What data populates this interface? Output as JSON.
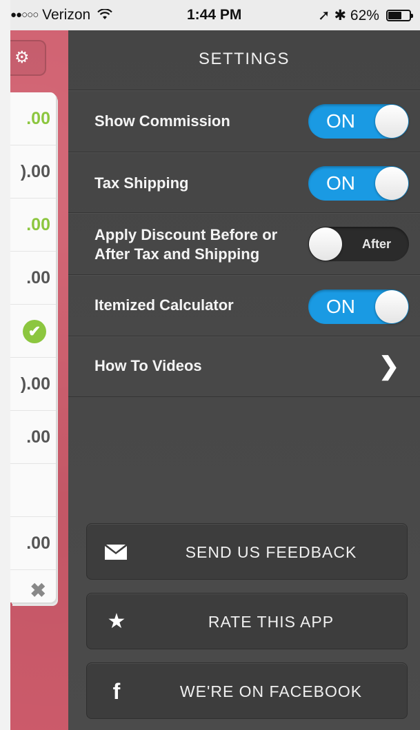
{
  "status_bar": {
    "signal_dots": "●●○○○",
    "carrier": "Verizon",
    "wifi_icon": "wifi-icon",
    "time": "1:44 PM",
    "location_icon": "➚",
    "bluetooth_icon": "✱",
    "battery_percent": "62%"
  },
  "background_app": {
    "gear_icon": "⚙",
    "rows": [
      {
        "text": ".00",
        "style": "green"
      },
      {
        "text": ").00",
        "style": "gray"
      },
      {
        "text": ".00",
        "style": "green"
      },
      {
        "text": ".00",
        "style": "gray"
      },
      {
        "text": "✔",
        "style": "check"
      },
      {
        "text": ").00",
        "style": "gray"
      },
      {
        "text": ".00",
        "style": "gray"
      },
      {
        "text": "",
        "style": "blank"
      },
      {
        "text": ".00",
        "style": "gray"
      }
    ],
    "close_icon": "✖"
  },
  "settings": {
    "title": "SETTINGS",
    "show_commission": {
      "label": "Show Commission",
      "state": "ON"
    },
    "tax_shipping": {
      "label": "Tax Shipping",
      "state": "ON"
    },
    "apply_discount": {
      "label_line1": "Apply Discount Before or",
      "label_line2": "After Tax and Shipping",
      "state": "After"
    },
    "itemized_calculator": {
      "label": "Itemized Calculator",
      "state": "ON"
    },
    "how_to_videos": {
      "label": "How To Videos",
      "chevron": "❯"
    }
  },
  "buttons": {
    "feedback": {
      "label": "SEND US FEEDBACK",
      "icon": "envelope-icon"
    },
    "rate": {
      "label": "RATE THIS APP",
      "icon": "★"
    },
    "facebook": {
      "label": "WE'RE ON FACEBOOK",
      "icon": "f"
    }
  },
  "colors": {
    "toggle_on": "#1a9ae3",
    "drawer_bg": "#464646",
    "background_panel": "#cf5c6c",
    "green_amount": "#8cc63f"
  }
}
